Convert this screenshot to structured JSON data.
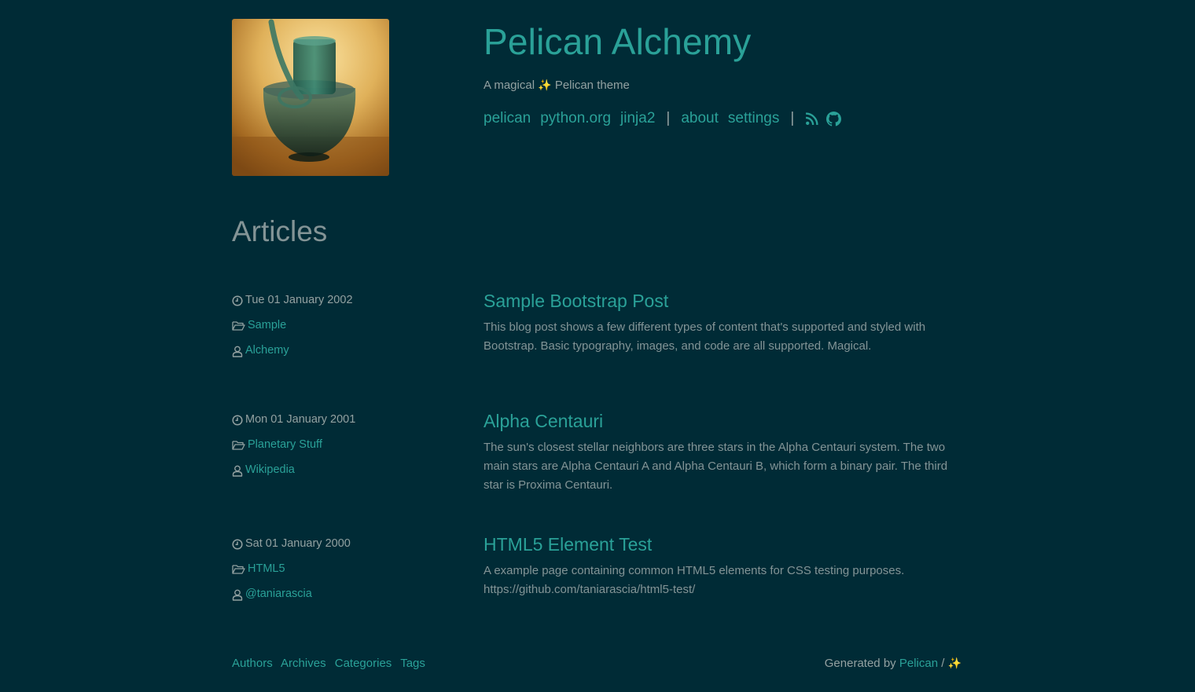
{
  "site": {
    "title": "Pelican Alchemy",
    "subtitle_prefix": "A magical",
    "subtitle_sparkle": "✨",
    "subtitle_suffix": "Pelican theme",
    "logo_icon": "glass-vessel-image"
  },
  "nav": {
    "links": [
      "pelican",
      "python.org",
      "jinja2"
    ],
    "separator": "|",
    "pages": [
      "about",
      "settings"
    ],
    "icons": [
      "rss-icon",
      "github-icon"
    ]
  },
  "articles_heading": "Articles",
  "articles": [
    {
      "date": "Tue 01 January 2002",
      "category": "Sample",
      "author": "Alchemy",
      "title": "Sample Bootstrap Post",
      "summary": "This blog post shows a few different types of content that's supported and styled with Bootstrap. Basic typography, images, and code are all supported. Magical."
    },
    {
      "date": "Mon 01 January 2001",
      "category": "Planetary Stuff",
      "author": "Wikipedia",
      "title": "Alpha Centauri",
      "summary": "The sun's closest stellar neighbors are three stars in the Alpha Centauri system. The two main stars are Alpha Centauri A and Alpha Centauri B, which form a binary pair. The third star is Proxima Centauri."
    },
    {
      "date": "Sat 01 January 2000",
      "category": "HTML5",
      "author": "@taniarascia",
      "title": "HTML5 Element Test",
      "summary": "A example page containing common HTML5 elements for CSS testing purposes. https://github.com/taniarascia/html5-test/"
    }
  ],
  "footer": {
    "links": [
      "Authors",
      "Archives",
      "Categories",
      "Tags"
    ],
    "generated_prefix": "Generated by",
    "generator": "Pelican",
    "slash": "/",
    "sparkle": "✨"
  },
  "colors": {
    "background": "#002b36",
    "accent": "#2aa198",
    "text": "#93a1a1",
    "muted": "#839496"
  }
}
